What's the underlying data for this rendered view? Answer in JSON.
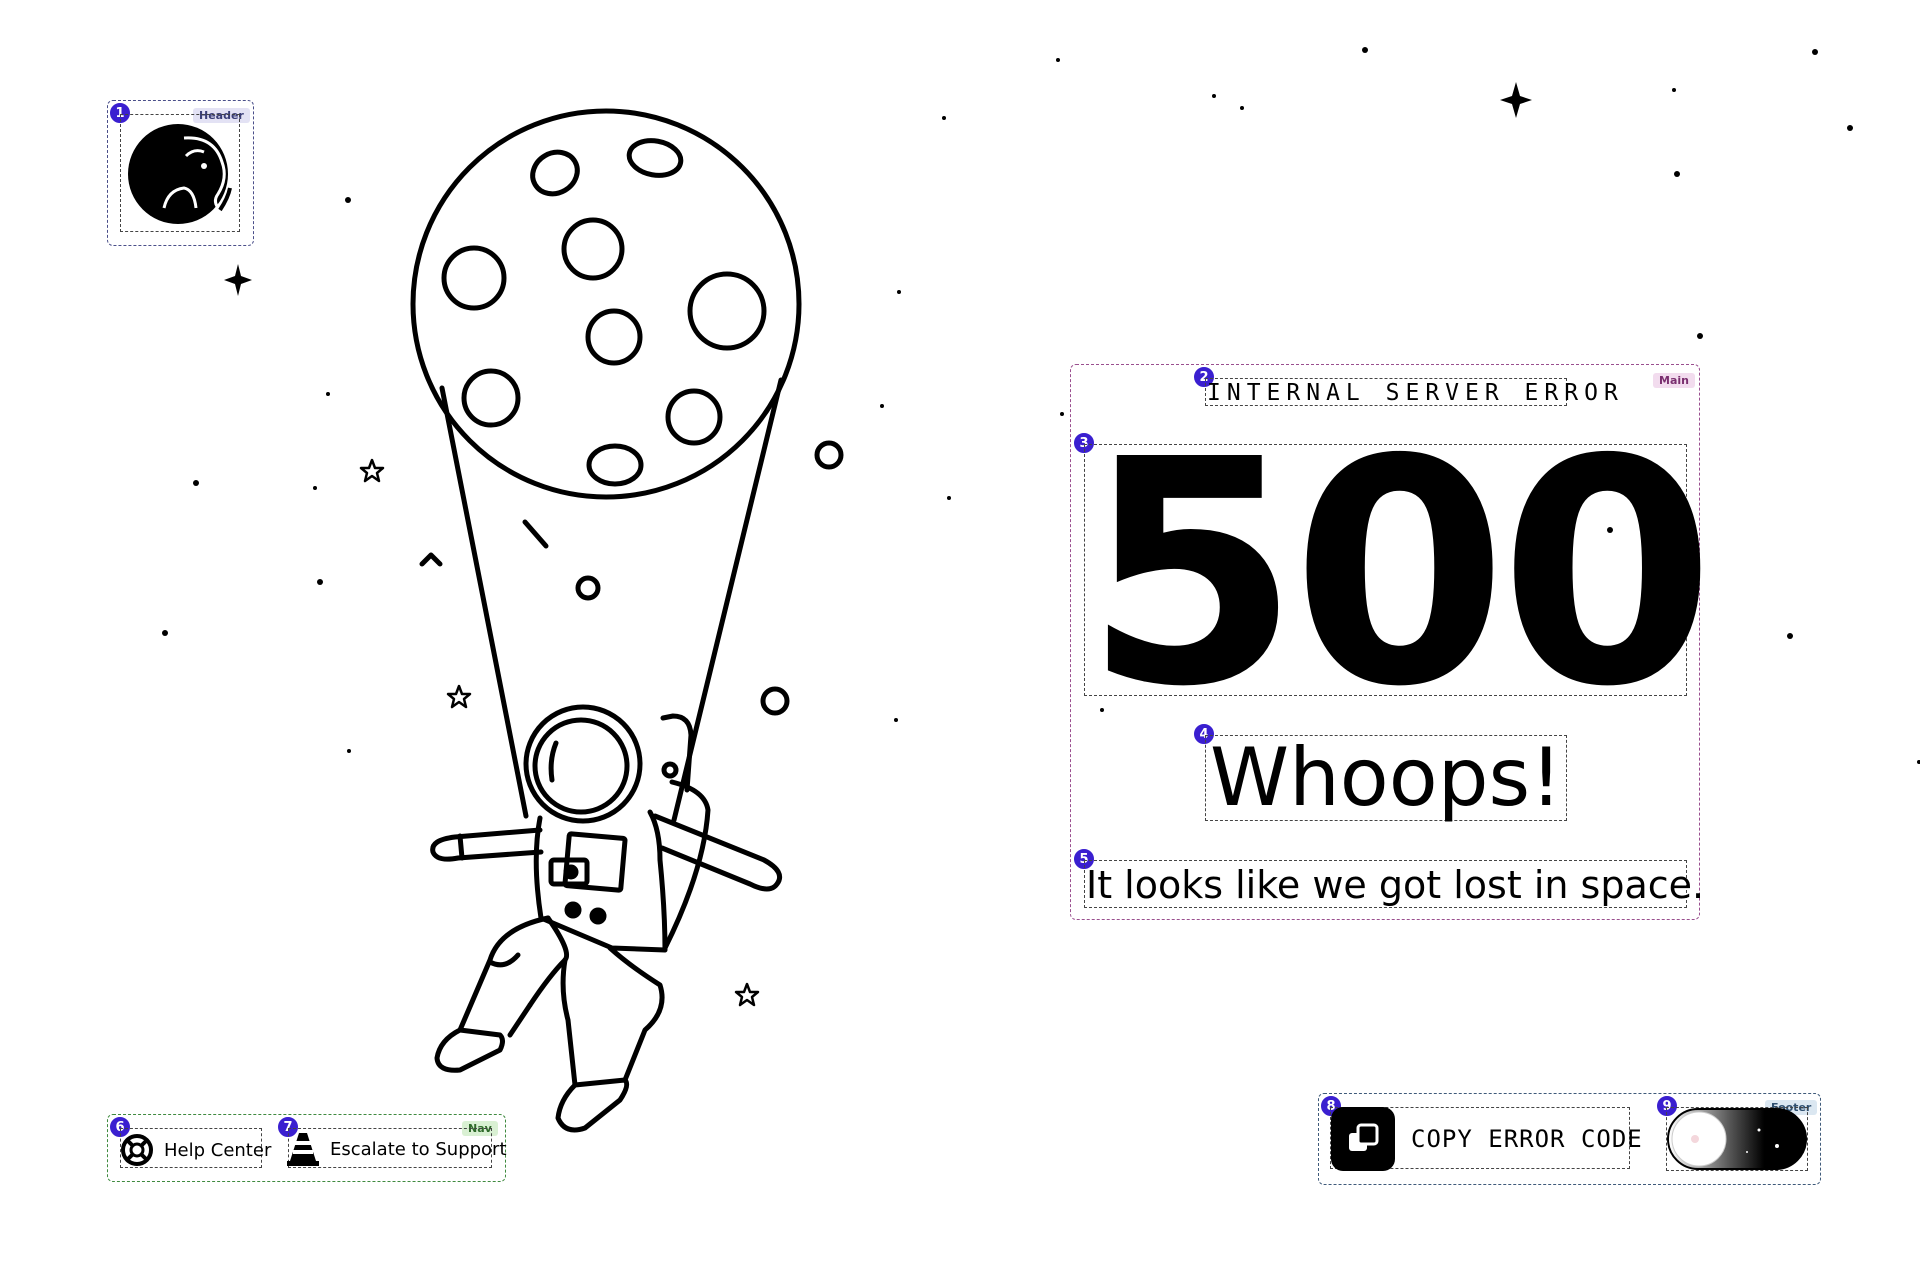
{
  "header": {
    "region_tag": "Header",
    "logo_icon": "elephant-icon",
    "badge": "1"
  },
  "main": {
    "region_tag": "Main",
    "kicker": "INTERNAL SERVER ERROR",
    "code": "500",
    "headline": "Whoops!",
    "message": "It looks like we got lost in space.",
    "badges": {
      "kicker": "2",
      "code": "3",
      "headline": "4",
      "message": "5"
    }
  },
  "nav": {
    "region_tag": "Nav",
    "items": [
      {
        "label": "Help Center",
        "icon": "lifebuoy-icon",
        "badge": "6"
      },
      {
        "label": "Escalate to Support",
        "icon": "traffic-cone-icon",
        "badge": "7"
      }
    ]
  },
  "footer": {
    "region_tag": "Footer",
    "copy_label": "COPY ERROR CODE",
    "copy_icon": "copy-icon",
    "copy_badge": "8",
    "theme_toggle_icon": "theme-toggle-icon",
    "theme_badge": "9"
  },
  "illustration": {
    "subject": "astronaut-balloon-moon"
  },
  "colors": {
    "ink": "#000000",
    "background": "#ffffff",
    "badge": "#3a1fd0"
  }
}
